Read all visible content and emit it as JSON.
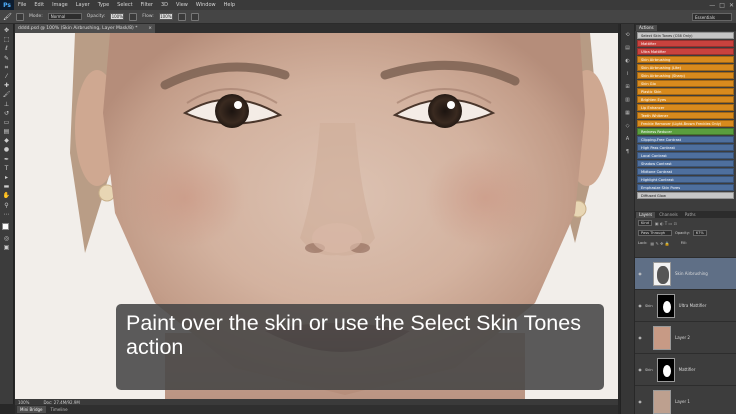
{
  "app": {
    "logo": "Ps"
  },
  "menu": [
    "File",
    "Edit",
    "Image",
    "Layer",
    "Type",
    "Select",
    "Filter",
    "3D",
    "View",
    "Window",
    "Help"
  ],
  "window_controls": [
    "—",
    "□",
    "✕"
  ],
  "options_bar": {
    "mode_label": "Mode:",
    "mode_value": "Normal",
    "opacity_label": "Opacity:",
    "opacity_value": "100%",
    "flow_label": "Flow:",
    "flow_value": "100%",
    "workspace": "Essentials"
  },
  "document": {
    "tab_title": "dddd.psd @ 100% (Skin Airbrushing, Layer Mask/8) *",
    "zoom": "100%",
    "doc_info": "Doc: 27.4M/92.9M"
  },
  "bottom_tabs": [
    "Mini Bridge",
    "Timeline"
  ],
  "caption": {
    "line1": "Paint over the skin or use the Select Skin Tones",
    "line2": "action"
  },
  "actions_panel": {
    "tab": "Actions",
    "items": [
      {
        "label": "Select Skin Tones (CS6 Only)",
        "color": "#c6c6c6"
      },
      {
        "label": "Mattifier",
        "color": "#c9423e"
      },
      {
        "label": "Ultra Mattifier",
        "color": "#c9423e"
      },
      {
        "label": "Skin Airbrushing",
        "color": "#d88a1d"
      },
      {
        "label": "Skin Airbrushing (Lite)",
        "color": "#d88a1d"
      },
      {
        "label": "Skin Airbrushing (Sharp)",
        "color": "#d88a1d"
      },
      {
        "label": "Skin Glo",
        "color": "#d88a1d"
      },
      {
        "label": "Plastic Skin",
        "color": "#d88a1d"
      },
      {
        "label": "Brighten Eyes",
        "color": "#d88a1d"
      },
      {
        "label": "Lip Enhancer",
        "color": "#d88a1d"
      },
      {
        "label": "Teeth Whitener",
        "color": "#d88a1d"
      },
      {
        "label": "Freckle Remover (Light-Brown Freckles Only)",
        "color": "#d88a1d"
      },
      {
        "label": "Redness Reducer",
        "color": "#5a9e3e"
      },
      {
        "label": "Clipping-Free Contrast",
        "color": "#4e6f9e"
      },
      {
        "label": "High Pass Contrast",
        "color": "#4e6f9e"
      },
      {
        "label": "Local Contrast",
        "color": "#4e6f9e"
      },
      {
        "label": "Shadow Contrast",
        "color": "#4e6f9e"
      },
      {
        "label": "Midtone Contrast",
        "color": "#4e6f9e"
      },
      {
        "label": "Highlight Contrast",
        "color": "#4e6f9e"
      },
      {
        "label": "Emphasize Skin Pores",
        "color": "#4e6f9e"
      },
      {
        "label": "Diffused Glow",
        "color": "#c6c6c6"
      }
    ]
  },
  "layers_panel": {
    "tabs": [
      "Layers",
      "Channels",
      "Paths"
    ],
    "kind_label": "Kind",
    "blend_value": "Pass Through",
    "opacity_label": "Opacity:",
    "opacity_value": "67%",
    "lock_label": "Lock:",
    "fill_label": "Fill:",
    "layers": [
      {
        "name": "Skin Airbrushing",
        "selected": true,
        "group": ""
      },
      {
        "name": "Ultra Mattifier",
        "selected": false,
        "group": "Skin"
      },
      {
        "name": "Layer 2",
        "selected": false,
        "group": ""
      },
      {
        "name": "Mattifier",
        "selected": false,
        "group": "Skin"
      },
      {
        "name": "Layer 1",
        "selected": false,
        "group": ""
      }
    ]
  }
}
